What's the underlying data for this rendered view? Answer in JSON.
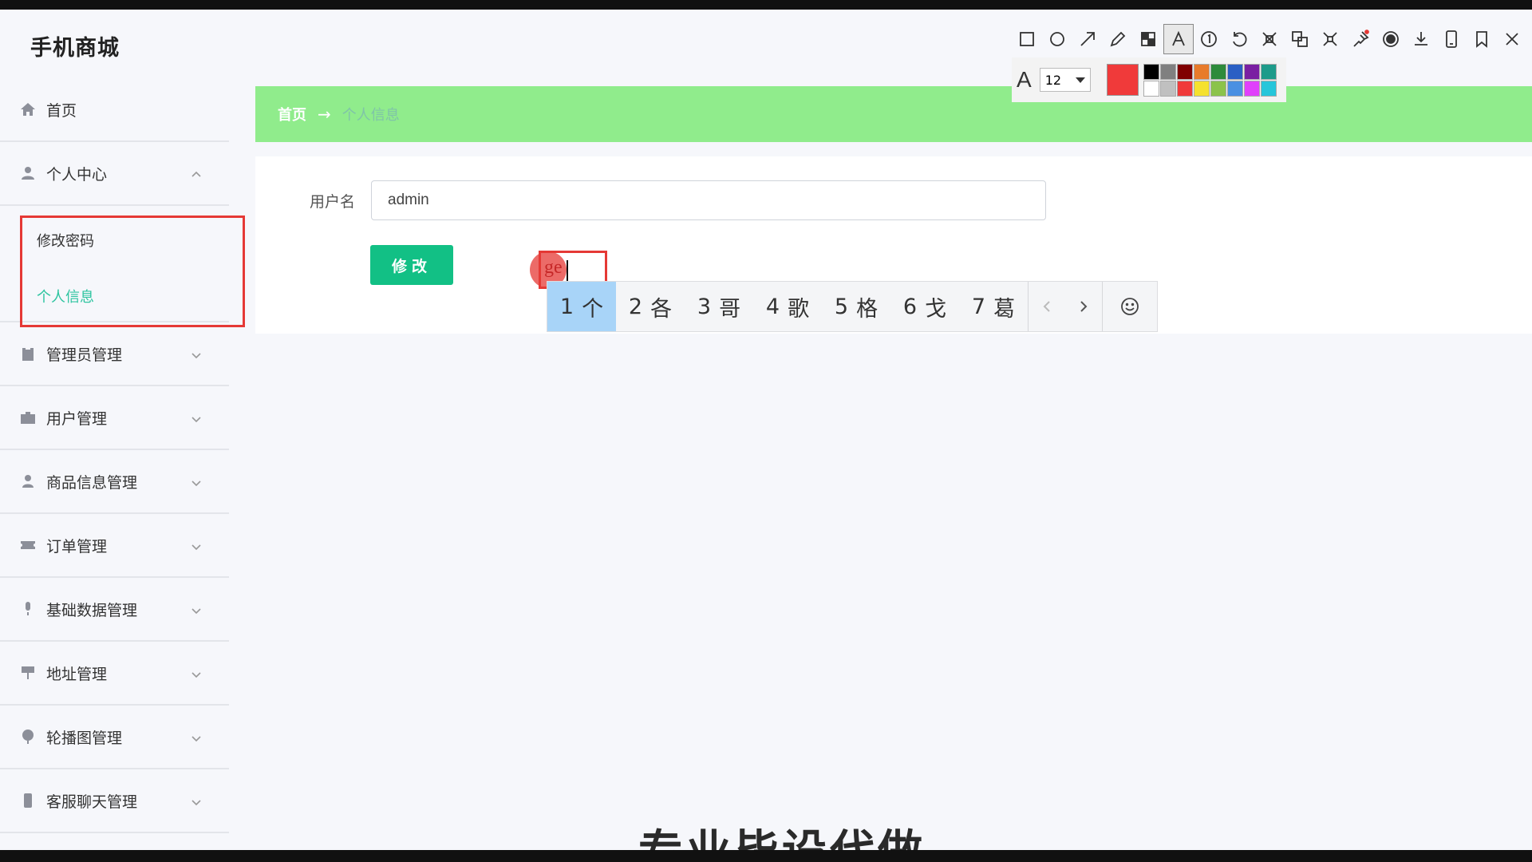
{
  "brand": "手机商城",
  "nav": {
    "home": "首页",
    "personal_center": "个人中心",
    "sub_change_password": "修改密码",
    "sub_personal_info": "个人信息",
    "admin_mgmt": "管理员管理",
    "user_mgmt": "用户管理",
    "goods_mgmt": "商品信息管理",
    "order_mgmt": "订单管理",
    "base_data_mgmt": "基础数据管理",
    "address_mgmt": "地址管理",
    "carousel_mgmt": "轮播图管理",
    "chat_mgmt": "客服聊天管理"
  },
  "breadcrumb": {
    "home": "首页",
    "arrow": "→",
    "current": "个人信息"
  },
  "form": {
    "username_label": "用户名",
    "username_value": "admin",
    "submit_label": "修改"
  },
  "annotation": {
    "typed_text": "ge"
  },
  "ime": {
    "candidates": [
      {
        "num": "1",
        "text": "个"
      },
      {
        "num": "2",
        "text": "各"
      },
      {
        "num": "3",
        "text": "哥"
      },
      {
        "num": "4",
        "text": "歌"
      },
      {
        "num": "5",
        "text": "格"
      },
      {
        "num": "6",
        "text": "戈"
      },
      {
        "num": "7",
        "text": "葛"
      }
    ]
  },
  "toolbar": {
    "font_symbol": "A",
    "font_size": "12",
    "current_color": "#f03a3a",
    "palette": [
      "#000000",
      "#808080",
      "#800000",
      "#e87b2a",
      "#2e8b3a",
      "#2a5fc4",
      "#7a1fa2",
      "#1e9b8a",
      "#ffffff",
      "#c0c0c0",
      "#f03a3a",
      "#f5e12e",
      "#8bc34a",
      "#4a90e2",
      "#e040fb",
      "#26c6da"
    ]
  },
  "overlay_text": "专业毕设代做",
  "colors": {
    "accent": "#12c085",
    "breadcrumb_bg": "#90ec8c",
    "annotation_red": "#e53935",
    "active_sub": "#2ec4a0"
  }
}
